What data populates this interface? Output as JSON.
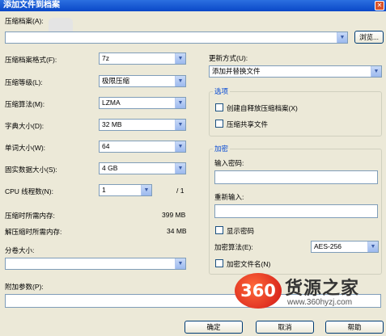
{
  "window": {
    "title": "添加文件到档案",
    "close_glyph": "✕"
  },
  "archive": {
    "label": "压缩档案(A):",
    "path_value": "",
    "browse_label": "浏览..."
  },
  "left": {
    "format": {
      "label": "压缩档案格式(F):",
      "value": "7z"
    },
    "level": {
      "label": "压缩等级(L):",
      "value": "极限压缩"
    },
    "method": {
      "label": "压缩算法(M):",
      "value": "LZMA"
    },
    "dict": {
      "label": "字典大小(D):",
      "value": "32 MB"
    },
    "word": {
      "label": "单词大小(W):",
      "value": "64"
    },
    "solid": {
      "label": "固实数据大小(S):",
      "value": "4 GB"
    },
    "threads": {
      "label": "CPU 线程数(N):",
      "value": "1",
      "total": "/ 1"
    },
    "mem_compress": {
      "label": "压缩时所需内存:",
      "value": "399 MB"
    },
    "mem_decompress": {
      "label": "解压缩时所需内存:",
      "value": "34 MB"
    },
    "volume": {
      "label": "分卷大小:",
      "value": ""
    },
    "params": {
      "label": "附加参数(P):",
      "value": ""
    }
  },
  "right": {
    "update": {
      "label": "更新方式(U):",
      "value": "添加并替换文件"
    },
    "options": {
      "title": "选项",
      "sfx_label": "创建自释放压缩档案(X)",
      "shared_label": "压缩共享文件"
    },
    "encryption": {
      "title": "加密",
      "password_label": "输入密码:",
      "password_value": "",
      "reenter_label": "重新输入:",
      "reenter_value": "",
      "show_password_label": "显示密码",
      "method_label": "加密算法(E):",
      "method_value": "AES-256",
      "encrypt_names_label": "加密文件名(N)"
    }
  },
  "buttons": {
    "ok": "确定",
    "cancel": "取消",
    "help": "帮助"
  },
  "watermark": {
    "logo_text": "360",
    "brand": "货源之家",
    "url": "www.360hyzj.com"
  },
  "icons": {
    "dropdown": "chevron-down-icon",
    "checkbox": "checkbox-icon"
  }
}
